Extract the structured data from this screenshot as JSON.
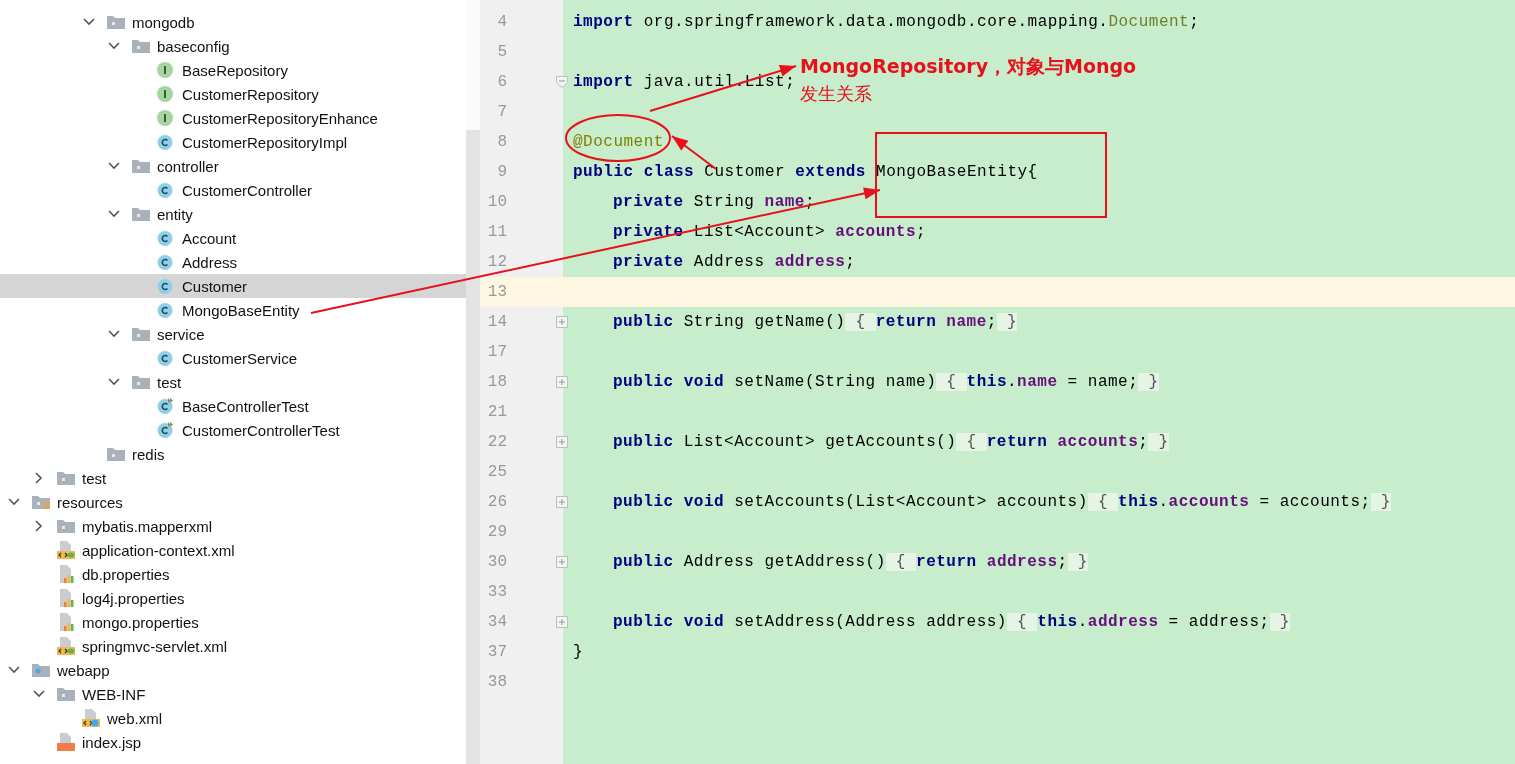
{
  "project_tree": [
    {
      "children": [
        {
          "children": [
            {
              "children": [
                {
                  "label": "mongodb",
                  "kind": "folder",
                  "expanded": true,
                  "selected": false,
                  "children": [
                    {
                      "label": "baseconfig",
                      "kind": "folder",
                      "expanded": true,
                      "selected": false,
                      "children": [
                        {
                          "label": "BaseRepository",
                          "kind": "interface",
                          "selected": false
                        },
                        {
                          "label": "CustomerRepository",
                          "kind": "interface",
                          "selected": false
                        },
                        {
                          "label": "CustomerRepositoryEnhance",
                          "kind": "interface",
                          "selected": false
                        },
                        {
                          "label": "CustomerRepositoryImpl",
                          "kind": "class",
                          "selected": false
                        }
                      ]
                    },
                    {
                      "label": "controller",
                      "kind": "folder",
                      "expanded": true,
                      "selected": false,
                      "children": [
                        {
                          "label": "CustomerController",
                          "kind": "class",
                          "selected": false
                        }
                      ]
                    },
                    {
                      "label": "entity",
                      "kind": "folder",
                      "expanded": true,
                      "selected": false,
                      "children": [
                        {
                          "label": "Account",
                          "kind": "class",
                          "selected": false
                        },
                        {
                          "label": "Address",
                          "kind": "class",
                          "selected": false
                        },
                        {
                          "label": "Customer",
                          "kind": "class",
                          "selected": true
                        },
                        {
                          "label": "MongoBaseEntity",
                          "kind": "class",
                          "selected": false
                        }
                      ]
                    },
                    {
                      "label": "service",
                      "kind": "folder",
                      "expanded": true,
                      "selected": false,
                      "children": [
                        {
                          "label": "CustomerService",
                          "kind": "class",
                          "selected": false
                        }
                      ]
                    },
                    {
                      "label": "test",
                      "kind": "folder",
                      "expanded": true,
                      "selected": false,
                      "children": [
                        {
                          "label": "BaseControllerTest",
                          "kind": "test-class",
                          "selected": false
                        },
                        {
                          "label": "CustomerControllerTest",
                          "kind": "test-class",
                          "selected": false
                        }
                      ]
                    }
                  ]
                },
                {
                  "label": "redis",
                  "kind": "folder",
                  "selected": false
                }
              ]
            }
          ]
        },
        {
          "label": "test",
          "kind": "folder",
          "expanded": false,
          "selected": false
        }
      ]
    },
    {
      "label": "resources",
      "kind": "resources-folder",
      "expanded": true,
      "selected": false,
      "children": [
        {
          "label": "mybatis.mapperxml",
          "kind": "folder",
          "expanded": false,
          "selected": false
        },
        {
          "label": "application-context.xml",
          "kind": "spring-xml",
          "selected": false
        },
        {
          "label": "db.properties",
          "kind": "properties",
          "selected": false
        },
        {
          "label": "log4j.properties",
          "kind": "properties",
          "selected": false
        },
        {
          "label": "mongo.properties",
          "kind": "properties",
          "selected": false
        },
        {
          "label": "springmvc-servlet.xml",
          "kind": "spring-xml",
          "selected": false
        }
      ]
    },
    {
      "label": "webapp",
      "kind": "web-folder",
      "expanded": true,
      "selected": false,
      "children": [
        {
          "label": "WEB-INF",
          "kind": "folder",
          "expanded": true,
          "selected": false,
          "children": [
            {
              "label": "web.xml",
              "kind": "web-xml",
              "selected": false
            }
          ]
        },
        {
          "label": "index.jsp",
          "kind": "jsp",
          "selected": false
        }
      ]
    }
  ],
  "editor": {
    "lines": [
      {
        "number": "4",
        "current": false,
        "folded": false,
        "fold_end": false,
        "indented": false,
        "tokens": [
          {
            "kind": "keyword",
            "text": "import"
          },
          {
            "kind": "plain",
            "text": " org.springframework.data.mongodb.core.mapping."
          },
          {
            "kind": "reference",
            "text": "Document"
          },
          {
            "kind": "plain",
            "text": ";"
          }
        ]
      },
      {
        "number": "5",
        "current": false,
        "folded": false,
        "fold_end": false
      },
      {
        "number": "6",
        "current": false,
        "folded": false,
        "fold_end": true,
        "indented": false,
        "tokens": [
          {
            "kind": "keyword",
            "text": "import"
          },
          {
            "kind": "plain",
            "text": " java.util.List;"
          }
        ]
      },
      {
        "number": "7",
        "current": false,
        "folded": false,
        "fold_end": false
      },
      {
        "number": "8",
        "current": false,
        "folded": false,
        "fold_end": false,
        "indented": false,
        "tokens": [
          {
            "kind": "annotation",
            "text": "@Document"
          }
        ]
      },
      {
        "number": "9",
        "current": false,
        "folded": false,
        "fold_end": false,
        "indented": false,
        "tokens": [
          {
            "kind": "keyword",
            "text": "public class"
          },
          {
            "kind": "plain",
            "text": " Customer "
          },
          {
            "kind": "keyword",
            "text": "extends"
          },
          {
            "kind": "plain",
            "text": " MongoBaseEntity{"
          }
        ]
      },
      {
        "number": "10",
        "current": false,
        "folded": false,
        "fold_end": false,
        "indented": true,
        "tokens": [
          {
            "kind": "keyword",
            "text": "private"
          },
          {
            "kind": "plain",
            "text": " String "
          },
          {
            "kind": "field",
            "text": "name"
          },
          {
            "kind": "plain",
            "text": ";"
          }
        ]
      },
      {
        "number": "11",
        "current": false,
        "folded": false,
        "fold_end": false,
        "indented": true,
        "tokens": [
          {
            "kind": "keyword",
            "text": "private"
          },
          {
            "kind": "plain",
            "text": " List<Account> "
          },
          {
            "kind": "field",
            "text": "accounts"
          },
          {
            "kind": "plain",
            "text": ";"
          }
        ]
      },
      {
        "number": "12",
        "current": false,
        "folded": false,
        "fold_end": false,
        "indented": true,
        "tokens": [
          {
            "kind": "keyword",
            "text": "private"
          },
          {
            "kind": "plain",
            "text": " Address "
          },
          {
            "kind": "field",
            "text": "address"
          },
          {
            "kind": "plain",
            "text": ";"
          }
        ]
      },
      {
        "number": "13",
        "current": true,
        "folded": false,
        "fold_end": false
      },
      {
        "number": "14",
        "current": false,
        "folded": true,
        "fold_end": false,
        "indented": true,
        "tokens": [
          {
            "kind": "keyword",
            "text": "public"
          },
          {
            "kind": "plain",
            "text": " String getName()"
          },
          {
            "kind": "folded",
            "text": " { "
          },
          {
            "kind": "keyword",
            "text": "return"
          },
          {
            "kind": "field",
            "text": " name"
          },
          {
            "kind": "plain",
            "text": ";"
          },
          {
            "kind": "folded",
            "text": " }"
          }
        ]
      },
      {
        "number": "17",
        "current": false,
        "folded": false,
        "fold_end": false
      },
      {
        "number": "18",
        "current": false,
        "folded": true,
        "fold_end": false,
        "indented": true,
        "tokens": [
          {
            "kind": "keyword",
            "text": "public void"
          },
          {
            "kind": "plain",
            "text": " setName(String name)"
          },
          {
            "kind": "folded",
            "text": " { "
          },
          {
            "kind": "keyword",
            "text": "this"
          },
          {
            "kind": "plain",
            "text": "."
          },
          {
            "kind": "field",
            "text": "name"
          },
          {
            "kind": "plain",
            "text": " = name;"
          },
          {
            "kind": "folded",
            "text": " }"
          }
        ]
      },
      {
        "number": "21",
        "current": false,
        "folded": false,
        "fold_end": false
      },
      {
        "number": "22",
        "current": false,
        "folded": true,
        "fold_end": false,
        "indented": true,
        "tokens": [
          {
            "kind": "keyword",
            "text": "public"
          },
          {
            "kind": "plain",
            "text": " List<Account> getAccounts()"
          },
          {
            "kind": "folded",
            "text": " { "
          },
          {
            "kind": "keyword",
            "text": "return"
          },
          {
            "kind": "field",
            "text": " accounts"
          },
          {
            "kind": "plain",
            "text": ";"
          },
          {
            "kind": "folded",
            "text": " }"
          }
        ]
      },
      {
        "number": "25",
        "current": false,
        "folded": false,
        "fold_end": false
      },
      {
        "number": "26",
        "current": false,
        "folded": true,
        "fold_end": false,
        "indented": true,
        "tokens": [
          {
            "kind": "keyword",
            "text": "public void"
          },
          {
            "kind": "plain",
            "text": " setAccounts(List<Account> accounts)"
          },
          {
            "kind": "folded",
            "text": " { "
          },
          {
            "kind": "keyword",
            "text": "this"
          },
          {
            "kind": "plain",
            "text": "."
          },
          {
            "kind": "field",
            "text": "accounts"
          },
          {
            "kind": "plain",
            "text": " = accounts;"
          },
          {
            "kind": "folded",
            "text": " }"
          }
        ]
      },
      {
        "number": "29",
        "current": false,
        "folded": false,
        "fold_end": false
      },
      {
        "number": "30",
        "current": false,
        "folded": true,
        "fold_end": false,
        "indented": true,
        "tokens": [
          {
            "kind": "keyword",
            "text": "public"
          },
          {
            "kind": "plain",
            "text": " Address getAddress()"
          },
          {
            "kind": "folded",
            "text": " { "
          },
          {
            "kind": "keyword",
            "text": "return"
          },
          {
            "kind": "field",
            "text": " address"
          },
          {
            "kind": "plain",
            "text": ";"
          },
          {
            "kind": "folded",
            "text": " }"
          }
        ]
      },
      {
        "number": "33",
        "current": false,
        "folded": false,
        "fold_end": false
      },
      {
        "number": "34",
        "current": false,
        "folded": true,
        "fold_end": false,
        "indented": true,
        "tokens": [
          {
            "kind": "keyword",
            "text": "public void"
          },
          {
            "kind": "plain",
            "text": " setAddress(Address address)"
          },
          {
            "kind": "folded",
            "text": " { "
          },
          {
            "kind": "keyword",
            "text": "this"
          },
          {
            "kind": "plain",
            "text": "."
          },
          {
            "kind": "field",
            "text": "address"
          },
          {
            "kind": "plain",
            "text": " = address;"
          },
          {
            "kind": "folded",
            "text": " }"
          }
        ]
      },
      {
        "number": "37",
        "current": false,
        "folded": false,
        "fold_end": false,
        "indented": false,
        "tokens": [
          {
            "kind": "plain",
            "text": "}"
          }
        ]
      },
      {
        "number": "38",
        "current": false,
        "folded": false,
        "fold_end": false
      }
    ]
  },
  "callout": {
    "title": "MongoRepository，对象与Mongo",
    "subtitle": "发生关系"
  }
}
